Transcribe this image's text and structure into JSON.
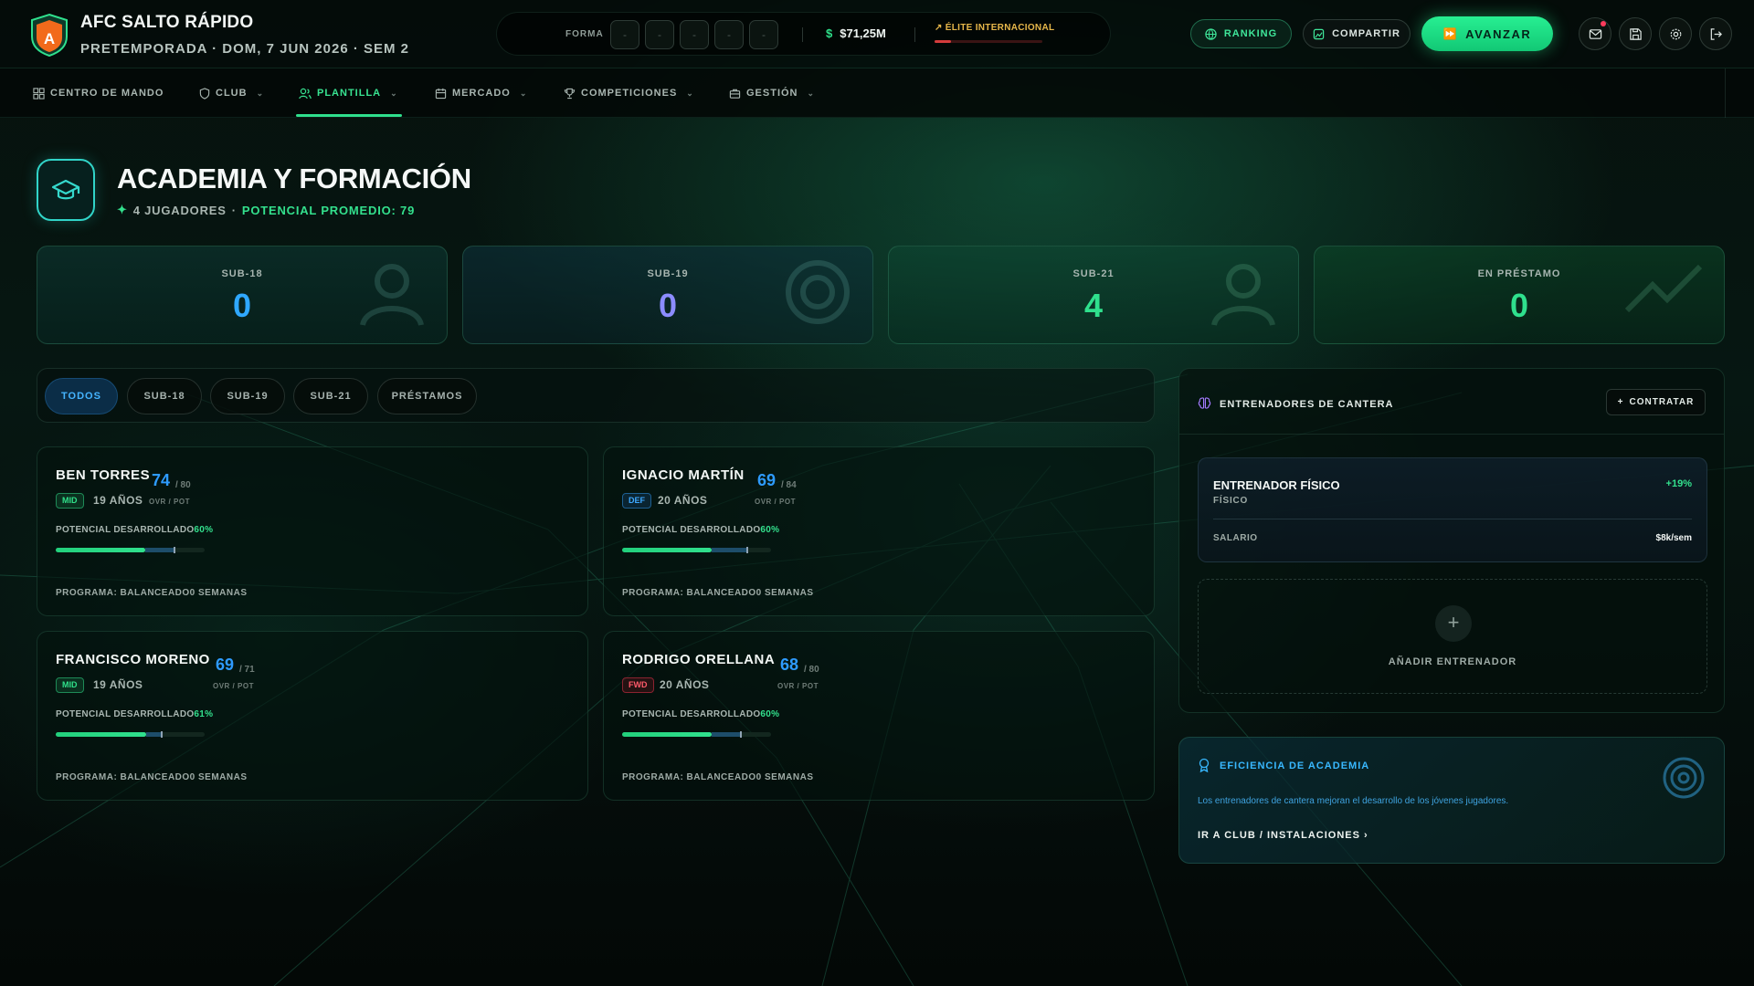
{
  "header": {
    "club_name": "AFC SALTO RÁPIDO",
    "club_logo_letter": "A",
    "subtitle": "PRETEMPORADA · DOM, 7 JUN 2026 · SEM 2",
    "forma_label": "FORMA",
    "forma_results": [
      "-",
      "-",
      "-",
      "-",
      "-"
    ],
    "money": "$71,25M",
    "elite_label": "ÉLITE INTERNACIONAL",
    "elite_progress_pct": 15,
    "ranking_label": "RANKING",
    "share_label": "COMPARTIR",
    "advance_label": "AVANZAR",
    "icons": [
      "mail-icon",
      "save-icon",
      "gear-icon",
      "logout-icon"
    ],
    "accent_color": "#2fe08d"
  },
  "nav": {
    "items": [
      {
        "label": "CENTRO DE MANDO",
        "icon": "dashboard-icon"
      },
      {
        "label": "CLUB",
        "icon": "shield-icon"
      },
      {
        "label": "PLANTILLA",
        "icon": "users-icon",
        "active": true
      },
      {
        "label": "MERCADO",
        "icon": "calendar-icon"
      },
      {
        "label": "COMPETICIONES",
        "icon": "trophy-icon"
      },
      {
        "label": "GESTIÓN",
        "icon": "briefcase-icon"
      }
    ]
  },
  "page": {
    "title": "ACADEMIA Y FORMACIÓN",
    "players_count": "4 JUGADORES",
    "separator": "·",
    "avg_potential": "POTENCIAL PROMEDIO: 79",
    "icon": "graduation-cap-icon"
  },
  "stats": [
    {
      "label": "SUB-18",
      "value": "0",
      "color": "#2fa8ff"
    },
    {
      "label": "SUB-19",
      "value": "0",
      "color": "#8c8cff"
    },
    {
      "label": "SUB-21",
      "value": "4",
      "color": "#2fe08d"
    },
    {
      "label": "EN PRÉSTAMO",
      "value": "0",
      "color": "#2fe08d"
    }
  ],
  "filters": [
    "TODOS",
    "SUB-18",
    "SUB-19",
    "SUB-21",
    "PRÉSTAMOS"
  ],
  "players": [
    {
      "name": "BEN TORRES",
      "ovr": "74",
      "pot": "/ 80",
      "position": "MID",
      "age": "19 AÑOS",
      "ovr_pot_label": "OVR / POT",
      "dev_label": "POTENCIAL DESARROLLADO",
      "dev_pct": "60%",
      "dev_value": 60,
      "pot_marker": 80,
      "program": "PROGRAMA: BALANCEADO",
      "weeks": "0 SEMANAS"
    },
    {
      "name": "IGNACIO MARTÍN",
      "ovr": "69",
      "pot": "/ 84",
      "position": "DEF",
      "age": "20 AÑOS",
      "ovr_pot_label": "OVR / POT",
      "dev_label": "POTENCIAL DESARROLLADO",
      "dev_pct": "60%",
      "dev_value": 60,
      "pot_marker": 84,
      "program": "PROGRAMA: BALANCEADO",
      "weeks": "0 SEMANAS"
    },
    {
      "name": "FRANCISCO MORENO",
      "ovr": "69",
      "pot": "/ 71",
      "position": "MID",
      "age": "19 AÑOS",
      "ovr_pot_label": "OVR / POT",
      "dev_label": "POTENCIAL DESARROLLADO",
      "dev_pct": "61%",
      "dev_value": 61,
      "pot_marker": 71,
      "program": "PROGRAMA: BALANCEADO",
      "weeks": "0 SEMANAS"
    },
    {
      "name": "RODRIGO ORELLANA",
      "ovr": "68",
      "pot": "/ 80",
      "position": "FWD",
      "age": "20 AÑOS",
      "ovr_pot_label": "OVR / POT",
      "dev_label": "POTENCIAL DESARROLLADO",
      "dev_pct": "60%",
      "dev_value": 60,
      "pot_marker": 80,
      "program": "PROGRAMA: BALANCEADO",
      "weeks": "0 SEMANAS"
    }
  ],
  "coaches": {
    "title": "ENTRENADORES DE CANTERA",
    "hire_label": "CONTRATAR",
    "coach": {
      "name": "ENTRENADOR FÍSICO",
      "type": "FÍSICO",
      "bonus": "+19%",
      "salary_label": "SALARIO",
      "salary": "$8k/sem"
    },
    "add_label": "AÑADIR ENTRENADOR"
  },
  "efficiency": {
    "title": "EFICIENCIA DE ACADEMIA",
    "text": "Los entrenadores de cantera mejoran el desarrollo de los jóvenes jugadores.",
    "link": "IR A CLUB / INSTALACIONES"
  }
}
